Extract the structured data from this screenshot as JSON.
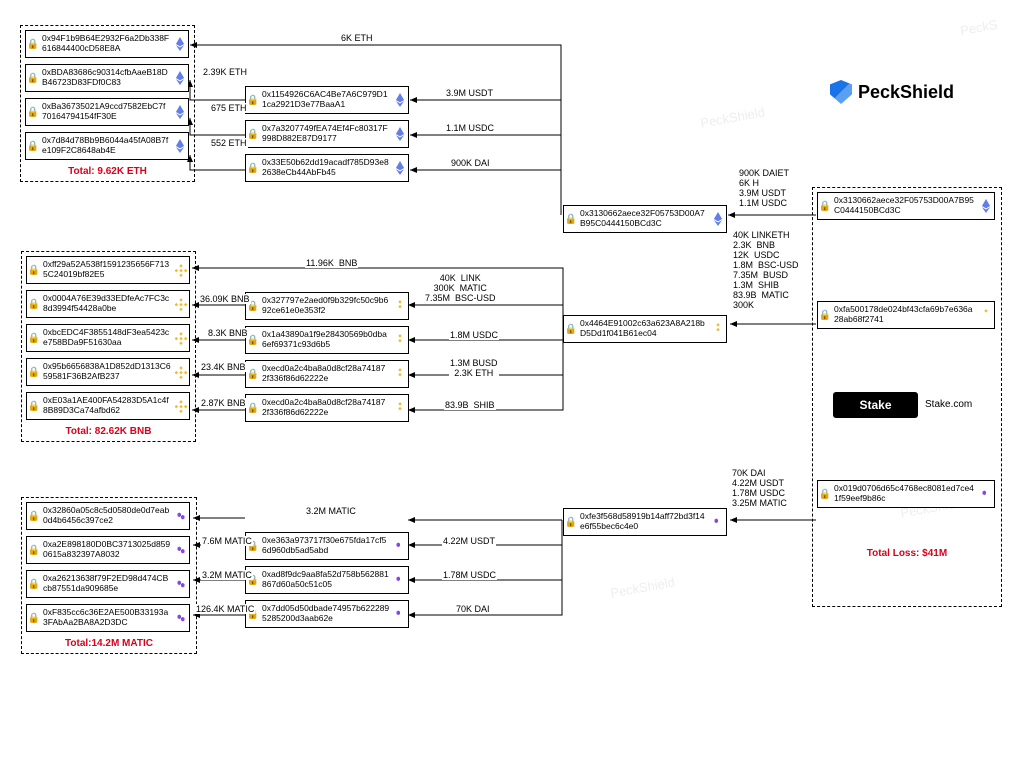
{
  "brand": {
    "name": "PeckShield",
    "stake": "Stake",
    "stake_site": "Stake.com"
  },
  "totals": {
    "eth": "Total: 9.62K ETH",
    "bnb": "Total: 82.62K BNB",
    "matic": "Total:14.2M MATIC",
    "loss": "Total Loss: $41M"
  },
  "eth_dest": [
    "0x94F1b9B64E2932F6a2Db338F616844400cD58E8A",
    "0xBDA83686c90314cfbAaeB18DB46723D83FDf0C83",
    "0xBa36735021A9ccd7582EbC7f70164794154fF30E",
    "0x7d84d78Bb9B6044a45fA08B7fe109F2C8648ab4E"
  ],
  "eth_mid": [
    "0x1154926C6AC4Be7A6C979D11ca2921D3e77BaaA1",
    "0x7a3207749fEA74Ef4Fc80317F998D882E87D9177",
    "0x33E50b62dd19acadf785D93e82638eCb44AbFb45"
  ],
  "eth_labels": {
    "l67": "6K ETH",
    "l239": "2.39K ETH",
    "l675": "675 ETH",
    "l552": "552 ETH",
    "l39m": "3.9M USDT",
    "l11m": "1.1M USDC",
    "l900k": "900K DAI"
  },
  "eth_hub": "0x3130662aece32F05753D00A7B95C0444150BCd3C",
  "bnb_dest": [
    "0xff29a52A538f1591235656F7135C24019bf82E5",
    "0x0004A76E39d33EDfeAc7FC3c8d3994f54428a0be",
    "0xbcEDC4F3855148dF3ea5423ce758BDa9F51630aa",
    "0x95b6656838A1D852dD1313C659581F36B2AfB237",
    "0xE03a1AE400FA54283D5A1c4f8B89D3Ca74afbd62"
  ],
  "bnb_mid": [
    "0x327797e2aed0f9b329fc50c9b692ce61e0e353f2",
    "0x1a43890a1f9e28430569b0dba6ef69371c93d6b5",
    "0xecd0a2c4ba8a0d8cf28a741872f336f86d62222e",
    "0xecd0a2c4ba8a0d8cf28a741872f336f86d62222e"
  ],
  "bnb_labels": {
    "l1196": "11.96K  BNB",
    "l3609": "36.09K BNB",
    "l83": "8.3K BNB",
    "l234": "23.4K BNB",
    "l287": "2.87K BNB",
    "mix": "40K  LINK\n300K  MATIC\n7.35M  BSC-USD",
    "l18m": "1.8M USDC",
    "l13m": "1.3M BUSD\n2.3K ETH",
    "l839b": "83.9B  SHIB"
  },
  "bnb_hub": "0x4464E91002c63a623A8A218bD5Dd1f041B61ec04",
  "matic_dest": [
    "0x32860a05c8c5d0580de0d7eab0d4b6456c397ce2",
    "0xa2E898180D0BC3713025d8590615a832397A8032",
    "0xa26213638f79F2ED98d474CBcb87551da909685e",
    "0xF835cc6c36E2AE500B33193a3FAbAa2BA8A2D3DC"
  ],
  "matic_mid": [
    "0xe363a973717f30e675fda17cf56d960db5ad5abd",
    "0xad8f9dc9aa8fa52d758b562881867d60a50c51c05",
    "0x7dd05d50dbade74957b6222895285200d3aab62e"
  ],
  "matic_labels": {
    "l32m": "3.2M MATIC",
    "l76m": "7.6M MATIC",
    "l32m2": "3.2M MATIC",
    "l1264": "126.4K MATIC",
    "l422": "4.22M USDT",
    "l178": "1.78M USDC",
    "l70k": "70K DAI"
  },
  "matic_hub": "0xfe3f568d58919b14aff72bd3f14e6f55bec6c4e0",
  "right_box1": "0x3130662aece32F05753D00A7B95C0444150BCd3C",
  "right_box2": "0xfa500178de024bf43cfa69b7e636a28ab68f2741",
  "right_box3": "0x019d0706d65c4768ec8081ed7ce41f59eef9b86c",
  "right_labels": {
    "top": "900K DAIET\n6K H\n3.9M USDT\n1.1M USDC",
    "mid": "40K LINKETH\n2.3K  BNB\n12K  USDC\n1.8M  BSC-USD\n7.35M  BUSD\n1.3M  SHIB\n83.9B  MATIC\n300K",
    "bot": "70K DAI\n4.22M USDT\n1.78M USDC\n3.25M MATIC"
  }
}
